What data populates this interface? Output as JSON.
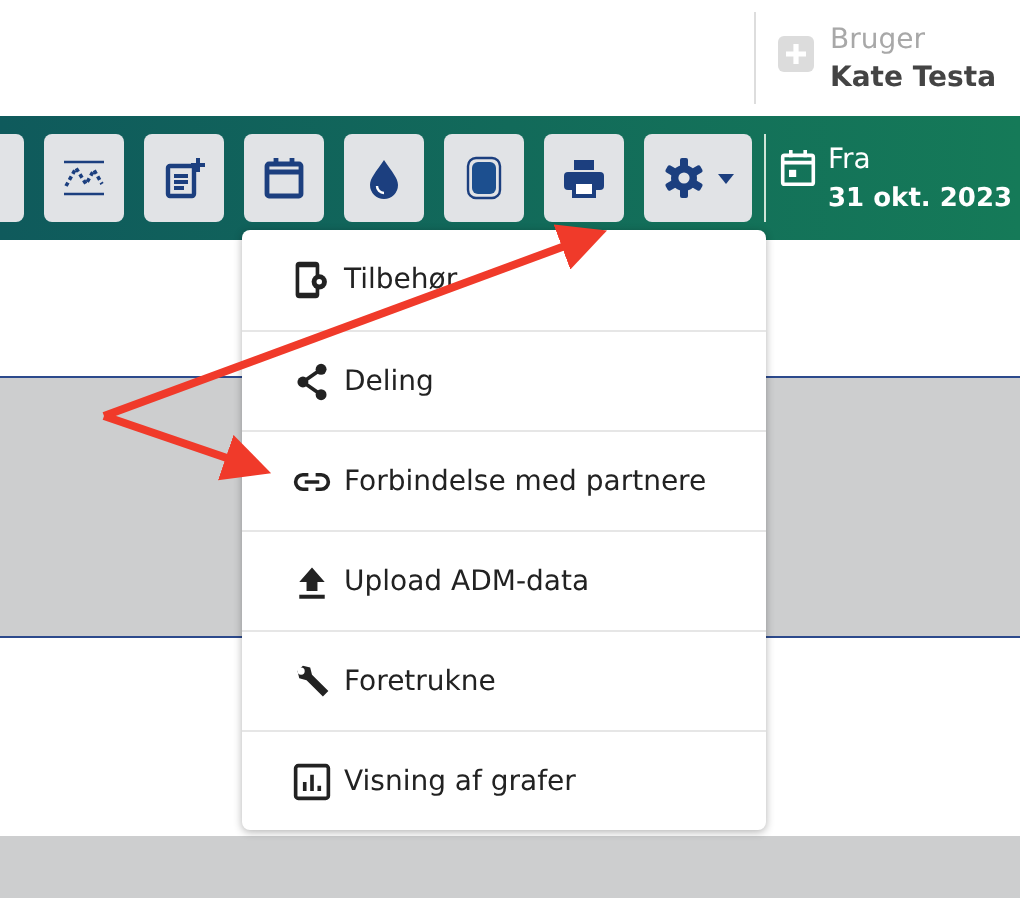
{
  "user": {
    "label": "Bruger",
    "name": "Kate Testa"
  },
  "toolbar": {
    "buttons": [
      {
        "kind": "partial"
      },
      {
        "kind": "wave"
      },
      {
        "kind": "note"
      },
      {
        "kind": "calendar"
      },
      {
        "kind": "drop"
      },
      {
        "kind": "device"
      },
      {
        "kind": "print"
      },
      {
        "kind": "gear"
      }
    ],
    "date": {
      "label": "Fra",
      "value": "31 okt. 2023"
    }
  },
  "menu": {
    "items": [
      {
        "kind": "phone-gear",
        "label": "Tilbehør"
      },
      {
        "kind": "share",
        "label": "Deling"
      },
      {
        "kind": "link",
        "label": "Forbindelse med partnere"
      },
      {
        "kind": "upload",
        "label": "Upload ADM-data"
      },
      {
        "kind": "wrench",
        "label": "Foretrukne"
      },
      {
        "kind": "chart",
        "label": "Visning af grafer"
      }
    ]
  }
}
